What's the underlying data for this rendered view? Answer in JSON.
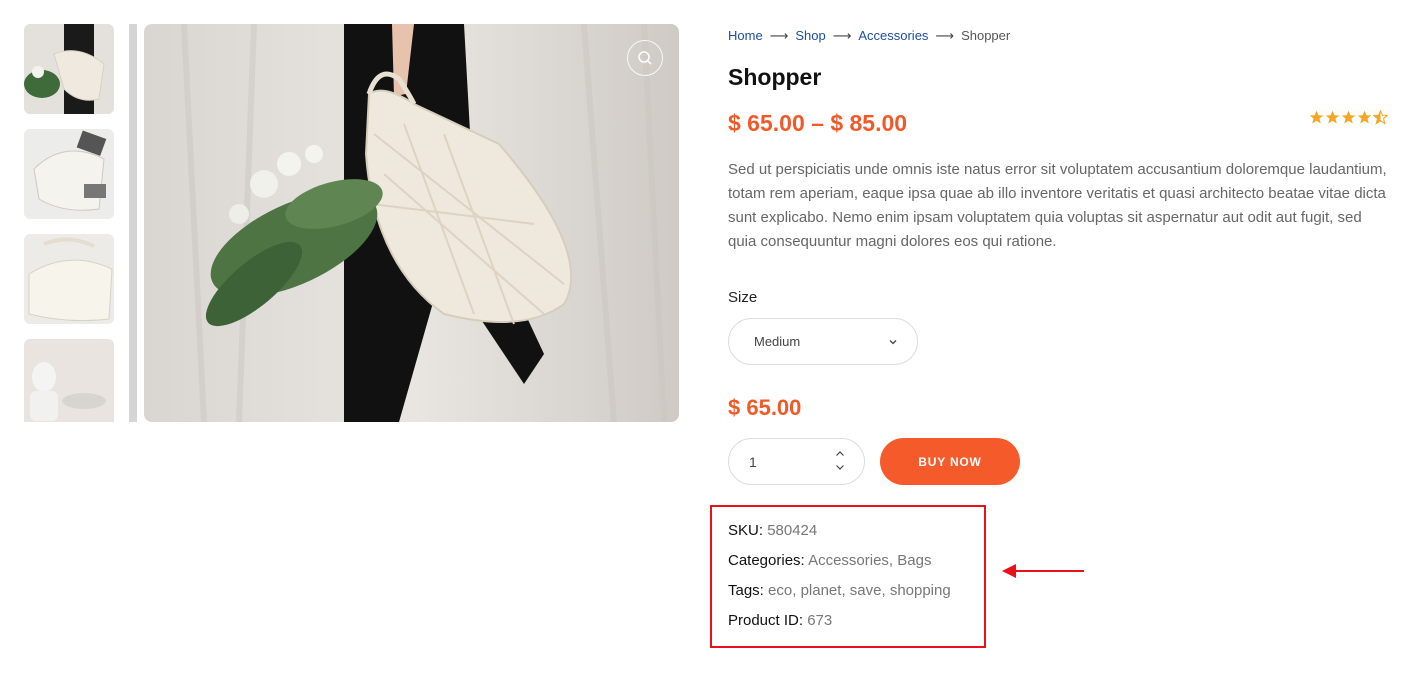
{
  "breadcrumb": {
    "home": "Home",
    "shop": "Shop",
    "accessories": "Accessories",
    "current": "Shopper",
    "separator": "⟶"
  },
  "product": {
    "title": "Shopper",
    "price_min": "$ 65.00",
    "price_dash": "–",
    "price_max": "$ 85.00",
    "rating": 4.5,
    "description": "Sed ut perspiciatis unde omnis iste natus error sit voluptatem accusantium doloremque laudantium, totam rem aperiam, eaque ipsa quae ab illo inventore veritatis et quasi architecto beatae vitae dicta sunt explicabo. Nemo enim ipsam voluptatem quia voluptas sit aspernatur aut odit aut fugit, sed quia consequuntur magni dolores eos qui ratione."
  },
  "variation": {
    "size_label": "Size",
    "size_selected": "Medium",
    "selected_price": "$ 65.00"
  },
  "cart": {
    "quantity": "1",
    "buy_label": "BUY NOW"
  },
  "meta": {
    "sku_label": "SKU:",
    "sku_value": "580424",
    "categories_label": "Categories:",
    "categories": [
      "Accessories",
      "Bags"
    ],
    "tags_label": "Tags:",
    "tags": [
      "eco",
      "planet",
      "save",
      "shopping"
    ],
    "product_id_label": "Product ID:",
    "product_id_value": "673"
  },
  "colors": {
    "accent": "#f05a28",
    "link": "#1d4ea0",
    "star": "#f5a623",
    "annotation": "#e8101a"
  },
  "icons": {
    "zoom": "search-icon",
    "dropdown": "chevron-down-icon",
    "stepper_up": "chevron-up-icon",
    "stepper_down": "chevron-down-icon",
    "annotation_arrow": "arrow-left-icon"
  }
}
